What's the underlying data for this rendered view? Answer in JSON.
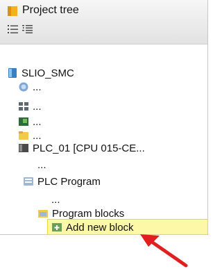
{
  "panel": {
    "title": "Project tree",
    "toolbar": [
      {
        "name": "list-view-icon"
      },
      {
        "name": "sort-list-icon"
      }
    ]
  },
  "tree": {
    "root": {
      "label": "SLIO_SMC",
      "icon": "plc-device-icon"
    },
    "items": [
      {
        "label": "...",
        "icon": "online-globe-icon"
      },
      {
        "label": "...",
        "icon": "network-icon"
      },
      {
        "label": "...",
        "icon": "hardware-module-icon"
      },
      {
        "label": "...",
        "icon": "folder-icon"
      },
      {
        "label": "PLC_01 [CPU 015-CE...",
        "icon": "cpu-icon"
      },
      {
        "label": "...",
        "icon": ""
      },
      {
        "label": "PLC Program",
        "icon": "plc-program-icon"
      },
      {
        "label": "...",
        "icon": ""
      },
      {
        "label": "Program blocks",
        "icon": "folder-open-icon"
      },
      {
        "label": "Add new block",
        "icon": "add-block-icon"
      }
    ]
  },
  "colors": {
    "selection": "#fdf7a8",
    "selection_border": "#e8d83c",
    "arrow": "#e02020"
  }
}
